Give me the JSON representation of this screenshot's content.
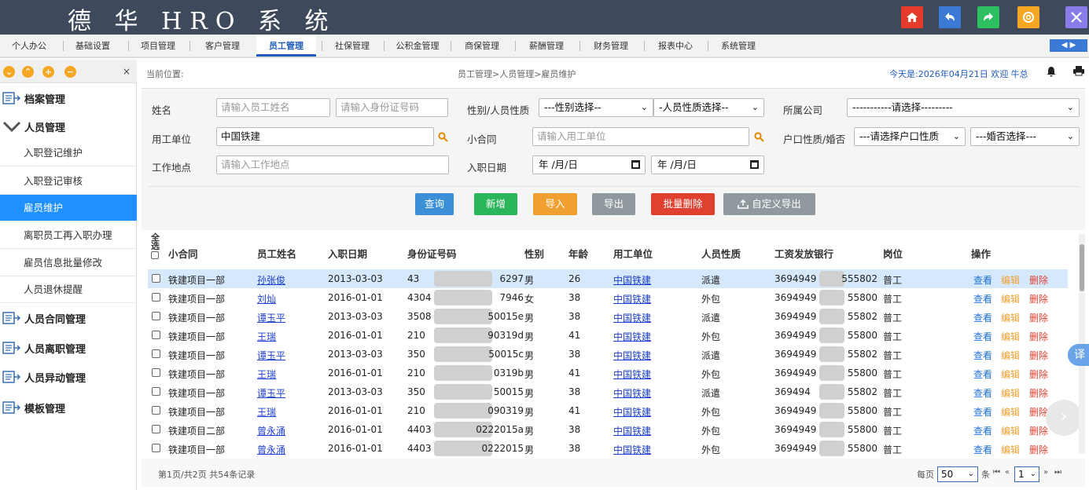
{
  "app": {
    "title": "德 华 HRO 系 统",
    "top_icons": [
      {
        "icon": "home-icon",
        "color": "#e63a2a"
      },
      {
        "icon": "back-arrow-icon",
        "color": "#3a7ad4"
      },
      {
        "icon": "forward-arrow-icon",
        "color": "#2cc060"
      },
      {
        "icon": "lifebuoy-icon",
        "color": "#f5a623"
      },
      {
        "icon": "close-icon",
        "color": "#8a7ce8"
      }
    ]
  },
  "nav": {
    "items": [
      "个人办公",
      "基础设置",
      "项目管理",
      "客户管理",
      "员工管理",
      "社保管理",
      "公积金管理",
      "商保管理",
      "薪酬管理",
      "财务管理",
      "报表中心",
      "系统管理"
    ],
    "active": "员工管理"
  },
  "sidebar": {
    "top_icons": [
      "collapse-icon",
      "expand-icon",
      "add-icon",
      "minus-icon"
    ],
    "close": "×",
    "groups": [
      {
        "label": "档案管理"
      },
      {
        "label": "人员管理"
      },
      {
        "label": "人员合同管理"
      },
      {
        "label": "人员离职管理"
      },
      {
        "label": "人员异动管理"
      },
      {
        "label": "模板管理"
      }
    ],
    "items": [
      "入职登记维护",
      "入职登记审核",
      "雇员维护",
      "离职员工再入职办理",
      "雇员信息批量修改",
      "人员退休提醒"
    ],
    "active_item": "雇员维护"
  },
  "crumb": {
    "label": "当前位置:",
    "path": "员工管理>人员管理>雇员维护",
    "date_greeting": "今天是:2026年04月21日 欢迎 牛总"
  },
  "filters": {
    "name_label": "姓名",
    "name_placeholder": "请输入员工姓名",
    "id_placeholder": "请输入身份证号码",
    "gender_label": "性别/人员性质",
    "gender_select": "---性别选择--",
    "type_select": "-人员性质选择--",
    "company_label": "所属公司",
    "company_select": "-----------请选择---------",
    "employer_label": "用工单位",
    "employer_value": "中国铁建",
    "contract_label": "小合同",
    "contract_placeholder": "请输入用工单位",
    "hukou_label": "户口性质/婚否",
    "hukou_select": "---请选择户口性质",
    "marriage_select": "---婚否选择---",
    "location_label": "工作地点",
    "location_placeholder": "请输入工作地点",
    "entry_date_label": "入职日期",
    "date_placeholder": "年 /月/日"
  },
  "buttons": {
    "query": "查询",
    "add": "新增",
    "import": "导入",
    "export": "导出",
    "batch_delete": "批量删除",
    "custom_export": "自定义导出"
  },
  "table": {
    "headers": {
      "select_all": "全选",
      "contract": "小合同",
      "name": "员工姓名",
      "entry_date": "入职日期",
      "id_number": "身份证号码",
      "gender": "性别",
      "age": "年龄",
      "employer": "用工单位",
      "type": "人员性质",
      "bank": "工资发放银行",
      "position": "岗位",
      "ops": "操作"
    },
    "rows": [
      {
        "contract": "铁建项目一部",
        "name": "孙张俊",
        "date": "2013-03-03",
        "id_a": "43",
        "id_b": "6297",
        "gender": "男",
        "age": "26",
        "employer": "中国铁建",
        "type": "派遣",
        "bank_a": "3694949",
        "bank_b": "555802",
        "position": "普工"
      },
      {
        "contract": "铁建项目一部",
        "name": "刘灿",
        "date": "2016-01-01",
        "id_a": "4304",
        "id_b": "7946",
        "gender": "女",
        "age": "38",
        "employer": "中国铁建",
        "type": "外包",
        "bank_a": "3694949",
        "bank_b": "55800",
        "position": "普工"
      },
      {
        "contract": "铁建项目一部",
        "name": "谭玉平",
        "date": "2013-03-03",
        "id_a": "3508",
        "id_b": "50015e",
        "gender": "男",
        "age": "38",
        "employer": "中国铁建",
        "type": "派遣",
        "bank_a": "3694949",
        "bank_b": "55802",
        "position": "普工"
      },
      {
        "contract": "铁建项目一部",
        "name": "王瑞",
        "date": "2016-01-01",
        "id_a": "210",
        "id_b": "90319d",
        "gender": "男",
        "age": "41",
        "employer": "中国铁建",
        "type": "外包",
        "bank_a": "3694949",
        "bank_b": "55800",
        "position": "普工"
      },
      {
        "contract": "铁建项目一部",
        "name": "谭玉平",
        "date": "2013-03-03",
        "id_a": "350",
        "id_b": "50015c",
        "gender": "男",
        "age": "38",
        "employer": "中国铁建",
        "type": "派遣",
        "bank_a": "3694949",
        "bank_b": "55802",
        "position": "普工"
      },
      {
        "contract": "铁建项目一部",
        "name": "王瑞",
        "date": "2016-01-01",
        "id_a": "210",
        "id_b": "0319b",
        "gender": "男",
        "age": "41",
        "employer": "中国铁建",
        "type": "外包",
        "bank_a": "3694949",
        "bank_b": "55800",
        "position": "普工"
      },
      {
        "contract": "铁建项目一部",
        "name": "谭玉平",
        "date": "2013-03-03",
        "id_a": "350",
        "id_b": "50015",
        "gender": "男",
        "age": "38",
        "employer": "中国铁建",
        "type": "派遣",
        "bank_a": "369494",
        "bank_b": "55802",
        "position": "普工"
      },
      {
        "contract": "铁建项目一部",
        "name": "王瑞",
        "date": "2016-01-01",
        "id_a": "210",
        "id_b": "090319",
        "gender": "男",
        "age": "41",
        "employer": "中国铁建",
        "type": "外包",
        "bank_a": "3694949",
        "bank_b": "55800",
        "position": "普工"
      },
      {
        "contract": "铁建项目二部",
        "name": "曾永涌",
        "date": "2016-01-01",
        "id_a": "4403",
        "id_b": "0222015a",
        "gender": "男",
        "age": "38",
        "employer": "中国铁建",
        "type": "外包",
        "bank_a": "3694949",
        "bank_b": "55800",
        "position": "普工"
      },
      {
        "contract": "铁建项目一部",
        "name": "曾永涌",
        "date": "2016-01-01",
        "id_a": "4403",
        "id_b": "0222015",
        "gender": "男",
        "age": "38",
        "employer": "中国铁建",
        "type": "外包",
        "bank_a": "3694949",
        "bank_b": "55800",
        "position": "普工"
      }
    ],
    "ops": {
      "view": "查看",
      "edit": "编辑",
      "delete": "删除"
    }
  },
  "footer": {
    "summary": "第1页/共2页 共54条记录",
    "per_page_label": "每页",
    "per_page_value": "50",
    "per_page_unit": "条",
    "page_value": "1"
  },
  "colors": {
    "topbar": "#3e4a5c",
    "accent": "#1e90ff",
    "query": "#3a8fd6",
    "add": "#2cb65c",
    "import": "#f0a030",
    "export": "#909a9e",
    "delete": "#e04030",
    "custom_export": "#909a9e"
  }
}
